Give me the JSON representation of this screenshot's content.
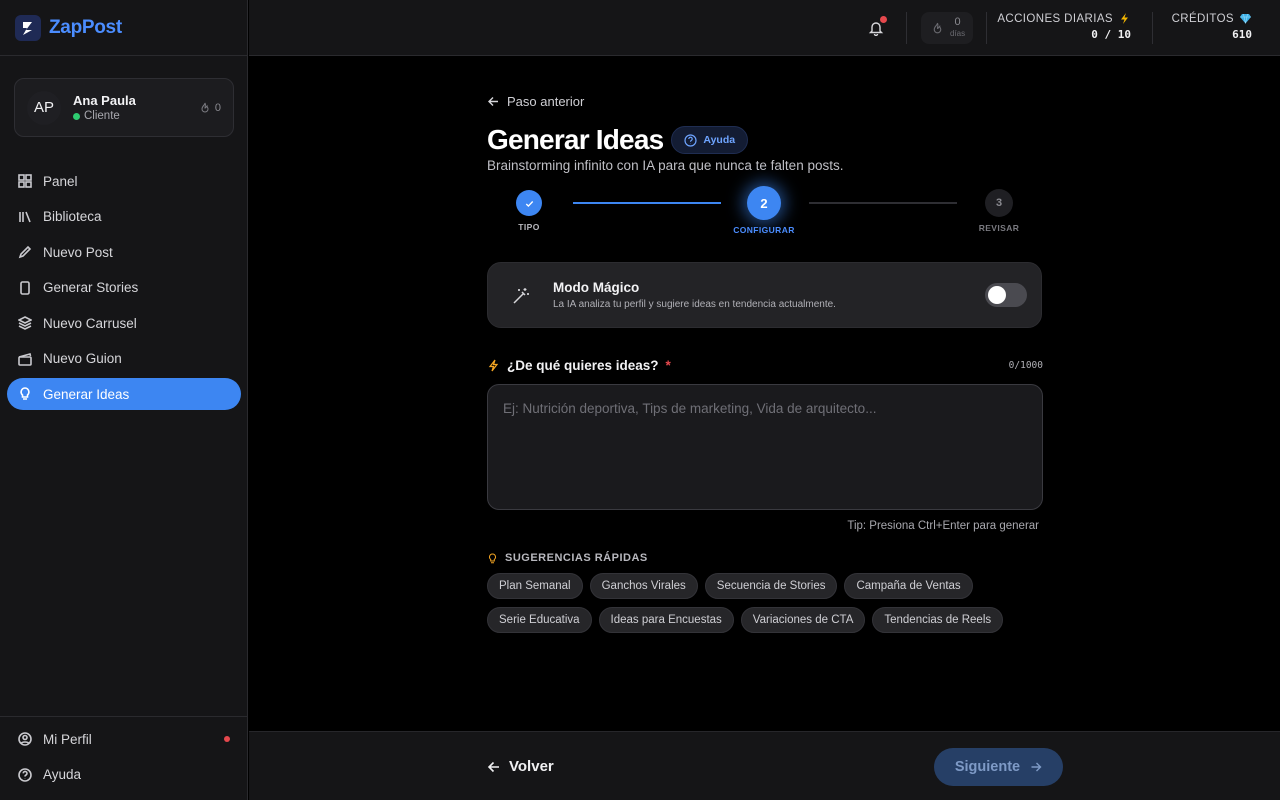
{
  "brand": {
    "name": "ZapPost",
    "logo_caption": "ZapPost"
  },
  "profile": {
    "initials": "AP",
    "name": "Ana Paula",
    "role": "Cliente",
    "streak": "0"
  },
  "nav": [
    {
      "id": "panel",
      "label": "Panel",
      "icon": "grid-icon"
    },
    {
      "id": "biblioteca",
      "label": "Biblioteca",
      "icon": "library-icon"
    },
    {
      "id": "nuevo-post",
      "label": "Nuevo Post",
      "icon": "pencil-icon"
    },
    {
      "id": "generar-stories",
      "label": "Generar Stories",
      "icon": "phone-icon"
    },
    {
      "id": "nuevo-carrusel",
      "label": "Nuevo Carrusel",
      "icon": "layers-icon"
    },
    {
      "id": "nuevo-guion",
      "label": "Nuevo Guion",
      "icon": "clapper-icon"
    },
    {
      "id": "generar-ideas",
      "label": "Generar Ideas",
      "icon": "lightbulb-icon",
      "active": true
    }
  ],
  "footer_nav": [
    {
      "label": "Mi Perfil",
      "icon": "user-circle-icon"
    },
    {
      "label": "Ayuda",
      "icon": "help-circle-icon"
    }
  ],
  "topbar": {
    "streak_value": "0",
    "streak_unit": "días",
    "daily_actions_label": "ACCIONES DIARIAS",
    "daily_actions_value": "0 / 10",
    "credits_label": "CRÉDITOS",
    "credits_value": "610"
  },
  "page": {
    "back_link": "Paso anterior",
    "title": "Generar Ideas",
    "help_label": "Ayuda",
    "subtitle": "Brainstorming infinito con IA para que nunca te falten posts."
  },
  "steps": [
    {
      "number": "1",
      "label": "TIPO",
      "state": "done"
    },
    {
      "number": "2",
      "label": "CONFIGURAR",
      "state": "active"
    },
    {
      "number": "3",
      "label": "REVISAR",
      "state": "pending"
    }
  ],
  "magic_mode": {
    "title": "Modo Mágico",
    "description": "La IA analiza tu perfil y sugiere ideas en tendencia actualmente.",
    "enabled": false
  },
  "idea_field": {
    "label": "¿De qué quieres ideas?",
    "required_mark": "*",
    "char_count": "0/1000",
    "placeholder": "Ej: Nutrición deportiva, Tips de marketing, Vida de arquitecto...",
    "value": "",
    "tip": "Tip: Presiona Ctrl+Enter para generar"
  },
  "suggestions": {
    "label": "SUGERENCIAS RÁPIDAS",
    "rows": [
      [
        "Plan Semanal",
        "Ganchos Virales",
        "Secuencia de Stories",
        "Campaña de Ventas"
      ],
      [
        "Serie Educativa",
        "Ideas para Encuestas",
        "Variaciones de CTA",
        "Tendencias de Reels"
      ]
    ]
  },
  "footer": {
    "back_label": "Volver",
    "next_label": "Siguiente"
  },
  "colors": {
    "accent": "#3d86f2",
    "brand": "#4b8dff",
    "danger": "#e5484d",
    "online": "#2ecc71"
  }
}
